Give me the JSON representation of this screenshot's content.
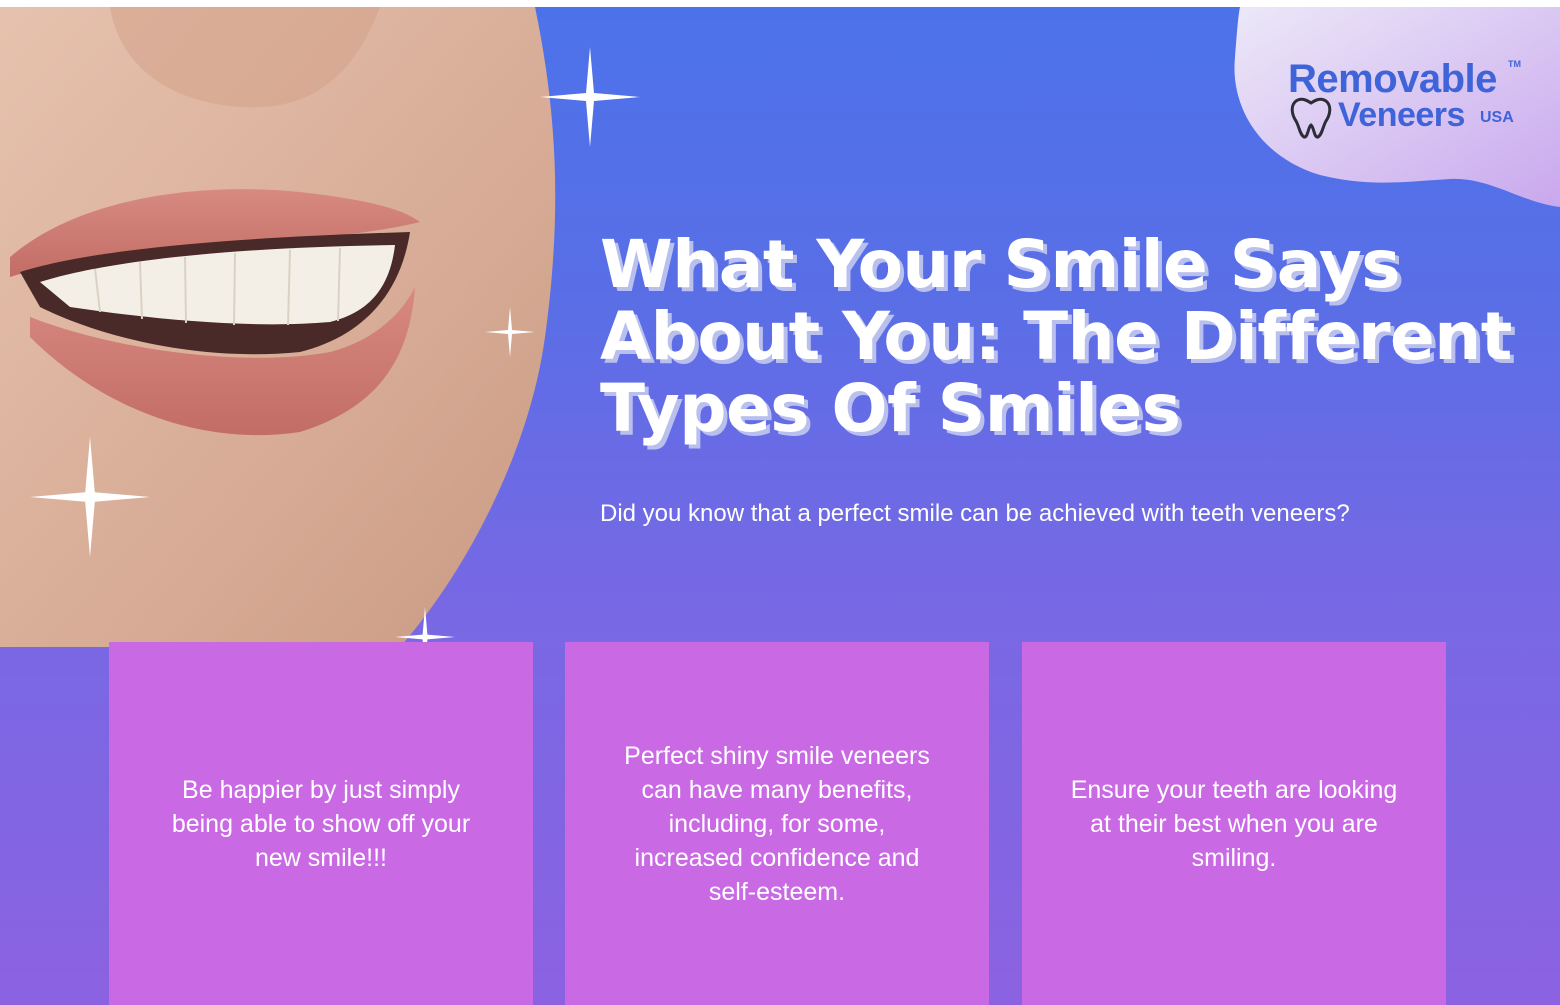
{
  "logo": {
    "line1": "Removable",
    "line2": "Veneers",
    "suffix": "USA",
    "tm": "TM",
    "icon": "tooth-icon"
  },
  "headline": "What Your Smile Says About You: The Different Types Of Smiles",
  "subtext": "Did you know that a perfect smile can be achieved with teeth veneers?",
  "cards": [
    {
      "text": "Be happier by just simply being able to show off your new smile!!!"
    },
    {
      "text": "Perfect shiny smile veneers can have many benefits, including, for some, increased confidence and self-esteem."
    },
    {
      "text": "Ensure your teeth are looking at their best when you are smiling."
    }
  ],
  "colors": {
    "background_top": "#4c72ea",
    "background_bottom": "#8b62e2",
    "card": "#c96ae4",
    "brand": "#3f63d8"
  }
}
